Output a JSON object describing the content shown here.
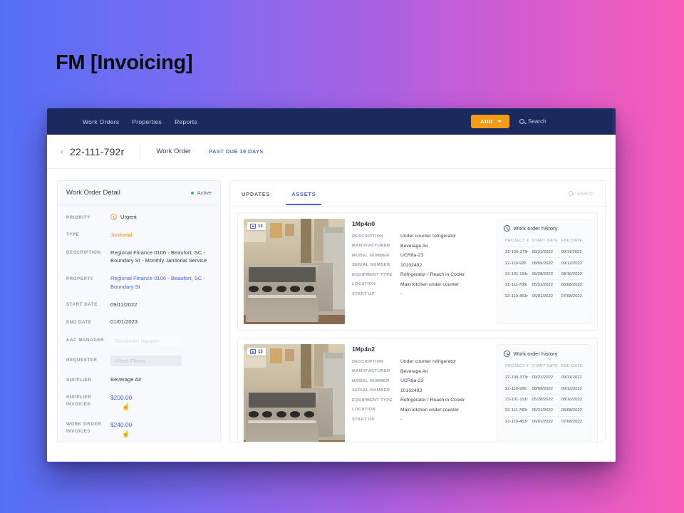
{
  "slide": {
    "title": "FM [Invoicing]"
  },
  "topnav": {
    "links": [
      "Work Orders",
      "Properties",
      "Reports"
    ],
    "add_label": "ADD",
    "search_placeholder": "Search"
  },
  "breadcrumb": {
    "back_icon": "chevron-left-icon",
    "work_order_number": "22-111-792r",
    "label": "Work Order",
    "status": "PAST DUE 19 DAYS"
  },
  "detail": {
    "title": "Work Order Detail",
    "status": "Active",
    "rows": [
      {
        "label": "PRIORITY",
        "value": "Urgent",
        "kind": "urgent"
      },
      {
        "label": "TYPE",
        "value": "Janitorial",
        "kind": "orange"
      },
      {
        "label": "DESCRIPTION",
        "value": "Regional Finance 0106 - Beaufort, SC - Boundary St - Monthly Janitorial Service",
        "kind": "text"
      },
      {
        "label": "PROPERTY",
        "value": "Regional Finance 0106 - Beaufort, SC - Boundary St",
        "kind": "link"
      },
      {
        "label": "START DATE",
        "value": "09/11/2022",
        "kind": "text"
      },
      {
        "label": "END DATE",
        "value": "01/01/2023",
        "kind": "text"
      },
      {
        "label": "AAC MANAGER",
        "value": "Savannah Nguyen",
        "kind": "ghost-pale"
      },
      {
        "label": "REQUESTER",
        "value": "Albert Flores",
        "kind": "ghost"
      },
      {
        "label": "SUPPLIER",
        "value": "Beverage Air",
        "kind": "text"
      },
      {
        "label": "SUPPLIER INVOICES",
        "value": "$200.00",
        "kind": "money"
      },
      {
        "label": "WORK ORDER INVOICES",
        "value": "$240.00",
        "kind": "money"
      }
    ]
  },
  "assets": {
    "tabs": [
      {
        "label": "UPDATES",
        "active": false
      },
      {
        "label": "ASSETS",
        "active": true
      }
    ],
    "search_placeholder": "Search",
    "spec_labels": [
      "DESCRIPTION",
      "MANUFACTURER",
      "MODEL NUMBER",
      "SERIAL NUMBER",
      "EQUIPMENT TYPE",
      "LOCATION",
      "START UP"
    ],
    "history_title": "Work order history",
    "history_columns": [
      "PROJECT #",
      "START DATE",
      "END DATE"
    ],
    "cards": [
      {
        "name": "1Mp4n0",
        "photo_count": "13",
        "specs": {
          "description": "Under counter refrigerator",
          "manufacturer": "Beverage Air",
          "model_number": "UCR8a-23",
          "serial_number": "10102492",
          "equipment_type": "Refrigerator / Reach in Cooler",
          "location": "Main kitchen under counter",
          "start_up": "-"
        },
        "history": [
          [
            "22-109-373r",
            "09/21/2022",
            "09/11/2022"
          ],
          [
            "22-110-926",
            "08/09/2022",
            "09/12/2022"
          ],
          [
            "23-101-191r",
            "05/28/2022",
            "08/10/2022"
          ],
          [
            "22-111-780r",
            "05/21/2022",
            "05/08/2022"
          ],
          [
            "22-110-453r",
            "06/01/2022",
            "07/08/2022"
          ]
        ]
      },
      {
        "name": "1Mp4n2",
        "photo_count": "13",
        "specs": {
          "description": "Under counter refrigerator",
          "manufacturer": "Beverage Air",
          "model_number": "UCR8a-23",
          "serial_number": "10102492",
          "equipment_type": "Refrigerator / Reach in Cooler",
          "location": "Main kitchen under counter",
          "start_up": "-"
        },
        "history": [
          [
            "22-109-373r",
            "09/21/2022",
            "09/11/2022"
          ],
          [
            "22-110-926",
            "08/09/2022",
            "09/12/2022"
          ],
          [
            "23-101-191r",
            "05/28/2022",
            "08/10/2022"
          ],
          [
            "22-111-780r",
            "05/21/2022",
            "05/08/2022"
          ],
          [
            "22-110-453r",
            "06/01/2022",
            "07/08/2022"
          ]
        ]
      }
    ]
  },
  "colors": {
    "nav_bg": "#1b2a5e",
    "accent_orange": "#f59c14",
    "accent_blue": "#4a63d8",
    "status_green": "#3fbb63",
    "gradient_start": "#5570f6",
    "gradient_end": "#f85cb8"
  }
}
